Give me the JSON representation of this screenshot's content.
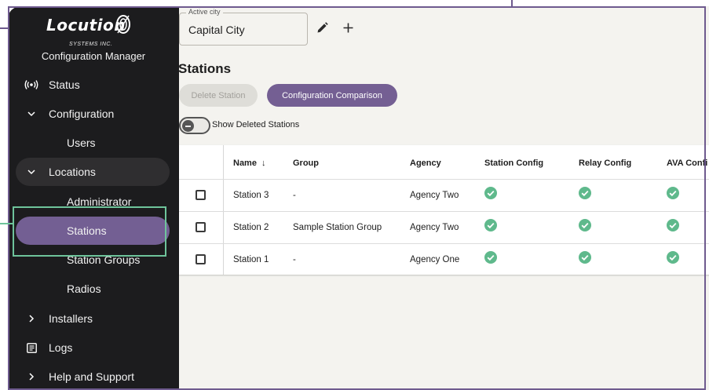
{
  "brand": {
    "logo_text": "Locution",
    "logo_sub": "SYSTEMS INC.",
    "app_name": "Configuration Manager"
  },
  "sidebar": {
    "items": [
      {
        "label": "Status",
        "icon": "broadcast-icon"
      },
      {
        "label": "Configuration",
        "icon": "chevron-down-icon"
      },
      {
        "label": "Users"
      },
      {
        "label": "Locations",
        "icon": "chevron-down-icon"
      },
      {
        "label": "Administrator"
      },
      {
        "label": "Stations"
      },
      {
        "label": "Station Groups"
      },
      {
        "label": "Radios"
      },
      {
        "label": "Installers",
        "icon": "chevron-right-icon"
      },
      {
        "label": "Logs",
        "icon": "document-icon"
      },
      {
        "label": "Help and Support",
        "icon": "chevron-right-icon"
      }
    ]
  },
  "city": {
    "legend": "Active city",
    "value": "Capital City"
  },
  "page": {
    "title": "Stations",
    "delete_label": "Delete Station",
    "compare_label": "Configuration Comparison",
    "toggle_label": "Show Deleted Stations"
  },
  "table": {
    "columns": [
      "Name",
      "Group",
      "Agency",
      "Station Config",
      "Relay Config",
      "AVA Confi"
    ],
    "sort_indicator": "↓",
    "rows": [
      {
        "name": "Station 3",
        "group": "-",
        "agency": "Agency Two",
        "station_config": "ok",
        "relay_config": "ok",
        "ava_config": "ok"
      },
      {
        "name": "Station 2",
        "group": "Sample Station Group",
        "agency": "Agency Two",
        "station_config": "ok",
        "relay_config": "ok",
        "ava_config": "ok"
      },
      {
        "name": "Station 1",
        "group": "-",
        "agency": "Agency One",
        "station_config": "ok",
        "relay_config": "ok",
        "ava_config": "ok"
      }
    ]
  },
  "colors": {
    "accent": "#745f93",
    "sidebar_bg": "#1c1c1e",
    "check_green": "#5fb98c",
    "highlight_green": "#6ec49b"
  }
}
